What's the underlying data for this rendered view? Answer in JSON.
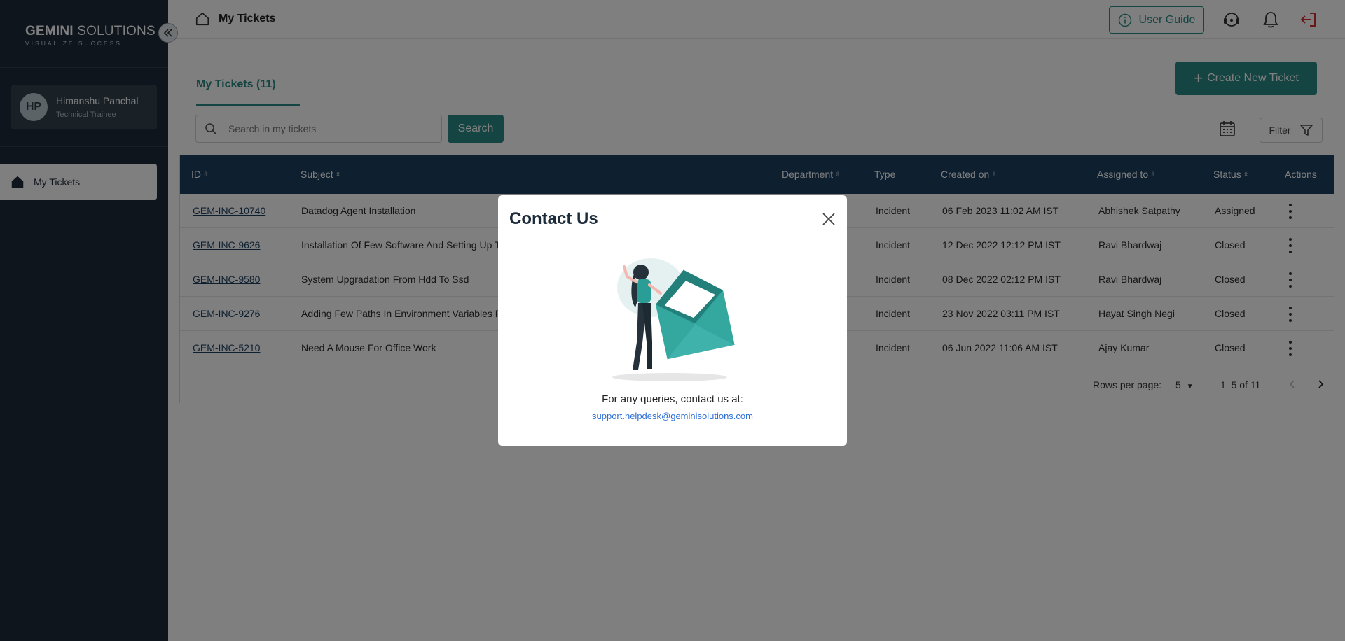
{
  "brand": {
    "name_bold": "GEMINI",
    "name_light": " SOLUTIONS",
    "tagline": "VISUALIZE SUCCESS"
  },
  "user": {
    "initials": "HP",
    "name": "Himanshu Panchal",
    "role": "Technical Trainee"
  },
  "sidebar": {
    "items": [
      {
        "label": "My Tickets",
        "icon": "home-icon"
      }
    ]
  },
  "header": {
    "title": "My Tickets",
    "user_guide_label": "User Guide"
  },
  "tabs": [
    {
      "label": "My Tickets (11)"
    }
  ],
  "actions": {
    "create_label": "Create New Ticket",
    "search_button": "Search",
    "filter_label": "Filter"
  },
  "search": {
    "placeholder": "Search in my tickets"
  },
  "table": {
    "columns": [
      "ID",
      "Subject",
      "Department",
      "Type",
      "Created on",
      "Assigned to",
      "Status",
      "Actions"
    ],
    "rows": [
      {
        "id": "GEM-INC-10740",
        "subject": "Datadog Agent Installation",
        "type": "Incident",
        "created": "06 Feb 2023 11:02 AM IST",
        "assigned": "Abhishek Satpathy",
        "status": "Assigned"
      },
      {
        "id": "GEM-INC-9626",
        "subject": "Installation Of Few Software And Setting Up T",
        "type": "Incident",
        "created": "12 Dec 2022 12:12 PM IST",
        "assigned": "Ravi Bhardwaj",
        "status": "Closed"
      },
      {
        "id": "GEM-INC-9580",
        "subject": "System Upgradation From Hdd To Ssd",
        "type": "Incident",
        "created": "08 Dec 2022 02:12 PM IST",
        "assigned": "Ravi Bhardwaj",
        "status": "Closed"
      },
      {
        "id": "GEM-INC-9276",
        "subject": "Adding Few Paths In Environment Variables F",
        "type": "Incident",
        "created": "23 Nov 2022 03:11 PM IST",
        "assigned": "Hayat Singh Negi",
        "status": "Closed"
      },
      {
        "id": "GEM-INC-5210",
        "subject": "Need A Mouse For Office Work",
        "type": "Incident",
        "created": "06 Jun 2022 11:06 AM IST",
        "assigned": "Ajay Kumar",
        "status": "Closed"
      }
    ]
  },
  "pagination": {
    "rows_label": "Rows per page:",
    "rows_value": "5",
    "range": "1–5 of 11"
  },
  "modal": {
    "title": "Contact Us",
    "text": "For any queries, contact us at:",
    "email": "support.helpdesk@geminisolutions.com"
  },
  "colors": {
    "accent": "#2a8b86",
    "sidebar": "#1c2b3a",
    "table_header": "#1c3f5f",
    "link": "#2e6fd6"
  }
}
